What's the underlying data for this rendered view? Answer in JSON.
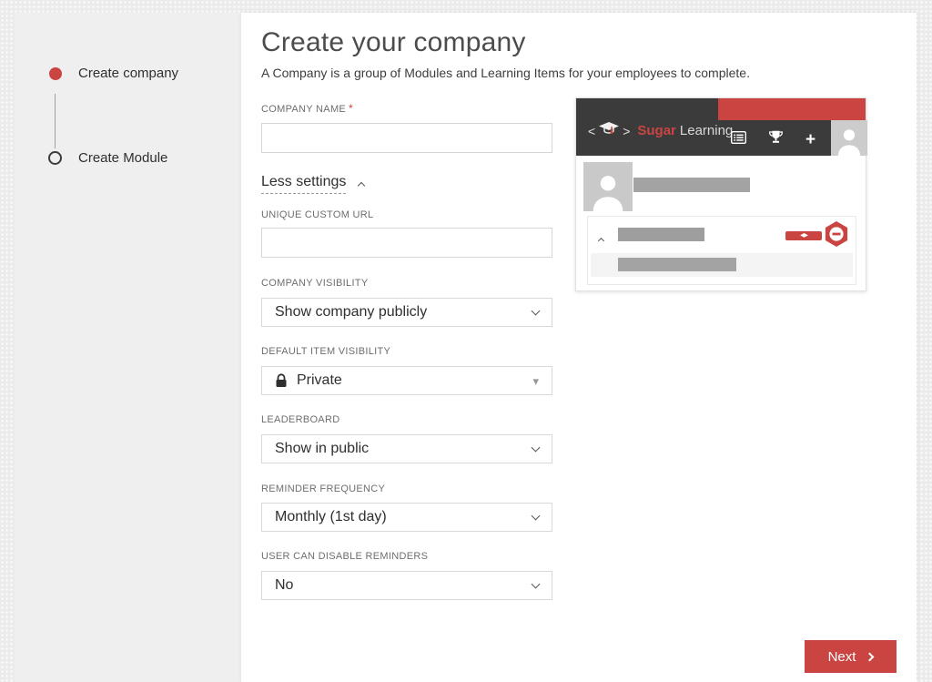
{
  "colors": {
    "accent_red": "#ca4542",
    "header_dark": "#3b3b3b"
  },
  "stepper": {
    "steps": [
      {
        "label": "Create company"
      },
      {
        "label": "Create Module"
      }
    ]
  },
  "page": {
    "title": "Create your company",
    "subtitle": "A Company is a group of Modules and Learning Items for your employees to complete."
  },
  "form": {
    "company_name_label": "COMPANY NAME",
    "required_mark": "*",
    "company_name_value": "",
    "less_settings_label": "Less settings",
    "custom_url_label": "UNIQUE CUSTOM URL",
    "custom_url_value": "",
    "company_visibility_label": "COMPANY VISIBILITY",
    "company_visibility_value": "Show company publicly",
    "default_item_visibility_label": "DEFAULT ITEM VISIBILITY",
    "default_item_visibility_value": "Private",
    "leaderboard_label": "LEADERBOARD",
    "leaderboard_value": "Show in public",
    "reminder_frequency_label": "REMINDER FREQUENCY",
    "reminder_frequency_value": "Monthly (1st day)",
    "user_can_disable_reminders_label": "USER CAN DISABLE REMINDERS",
    "user_can_disable_reminders_value": "No",
    "next_label": "Next"
  },
  "preview": {
    "logo_left": "<",
    "logo_right": ">",
    "brand_primary": "Sugar",
    "brand_secondary": "Learning",
    "plus": "+"
  }
}
